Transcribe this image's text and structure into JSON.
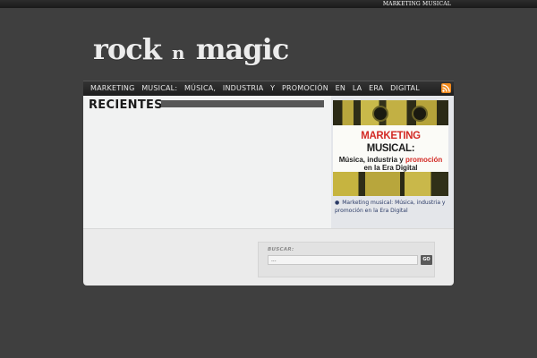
{
  "topbar": {
    "link_label": "MARKETING MUSICAL"
  },
  "site": {
    "logo_part1": "rock",
    "logo_part2": "n",
    "logo_part3": "magic"
  },
  "nav": {
    "item_label": "MARKETING MUSICAL: MÚSICA, INDUSTRIA Y PROMOCIÓN EN LA ERA DIGITAL",
    "rss_icon": "rss-feed-icon"
  },
  "main": {
    "section_title": "RECIENTES"
  },
  "sidebar": {
    "book": {
      "line1_red": "MARKETING",
      "line1_black": "MUSICAL:",
      "line2a": "Música, industria y",
      "line2b": "promoción",
      "line3": "en la Era Digital"
    },
    "link_text": "Marketing musical: Música, industria y promoción en la Era Digital"
  },
  "search": {
    "label": "BUSCAR:",
    "value": "...",
    "button_label": "GO"
  },
  "colors": {
    "background": "#3f3f3f",
    "accent_red": "#d32a25",
    "rss": "#f18a1d"
  }
}
